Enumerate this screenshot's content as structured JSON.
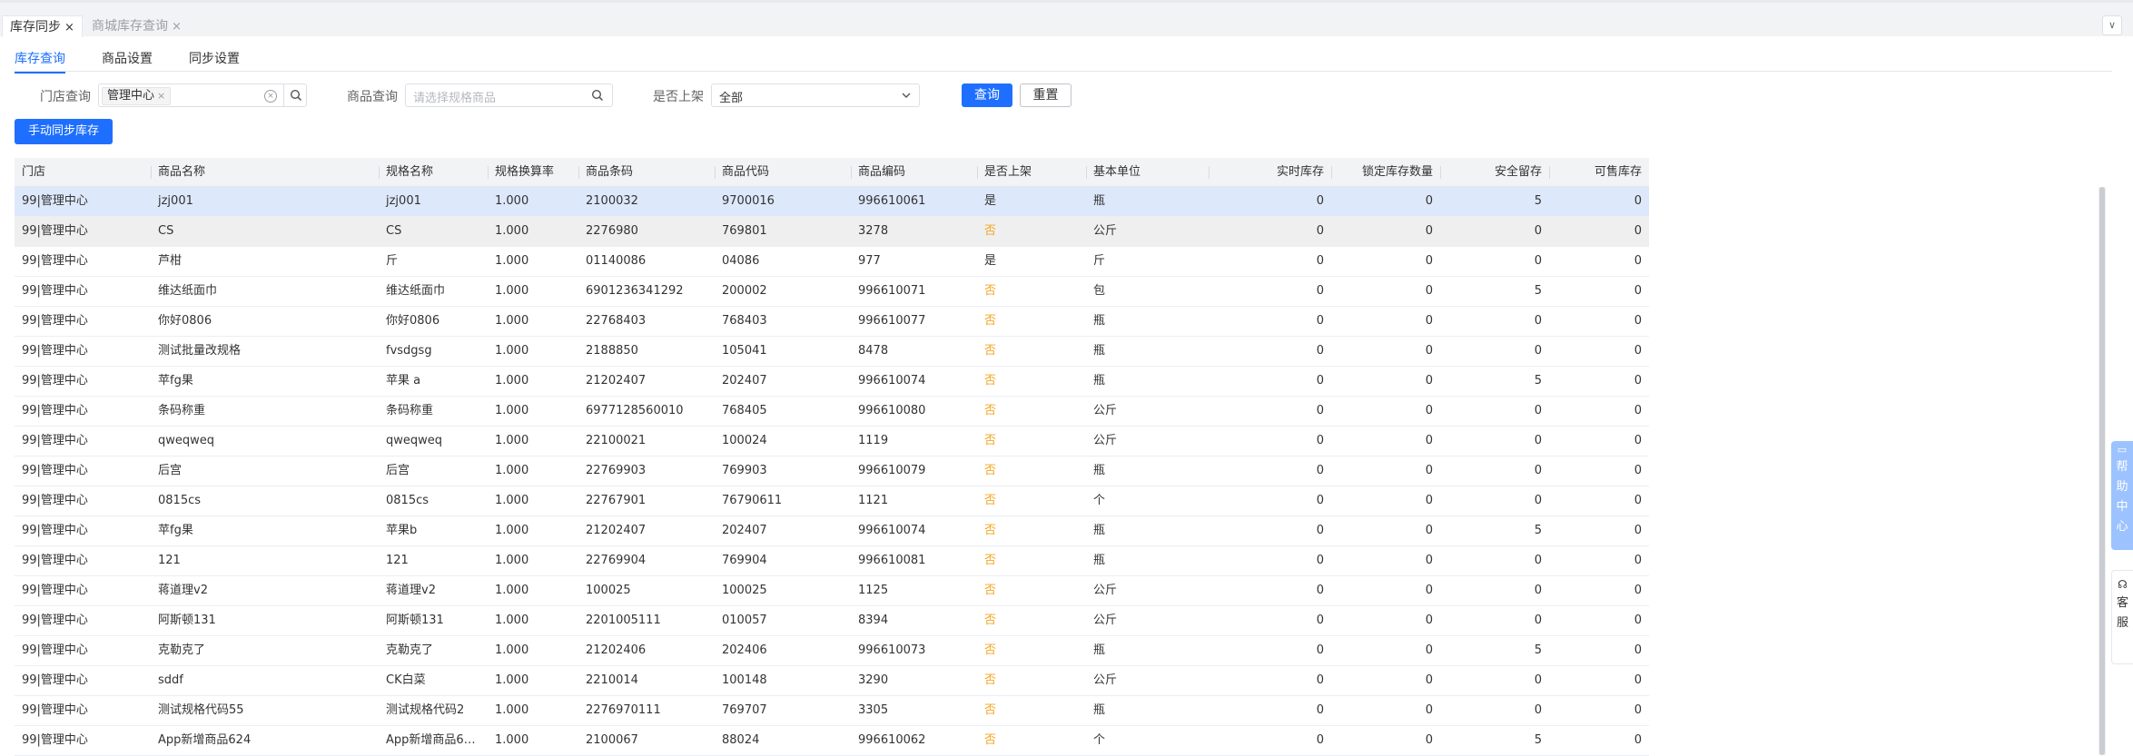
{
  "page_tabs": [
    {
      "label": "库存同步",
      "active": true
    },
    {
      "label": "商城库存查询",
      "active": false
    }
  ],
  "close_glyph": "×",
  "menu_glyph": "∨",
  "sub_tabs": [
    "库存查询",
    "商品设置",
    "同步设置"
  ],
  "filters": {
    "store_label": "门店查询",
    "store_chip": "管理中心",
    "product_label": "商品查询",
    "product_placeholder": "请选择规格商品",
    "listed_label": "是否上架",
    "listed_value": "全部",
    "query_button": "查询",
    "reset_button": "重置"
  },
  "sync_button": "手动同步库存",
  "table": {
    "columns": [
      "门店",
      "商品名称",
      "规格名称",
      "规格换算率",
      "商品条码",
      "商品代码",
      "商品编码",
      "是否上架",
      "基本单位",
      "实时库存",
      "锁定库存数量",
      "安全留存",
      "可售库存"
    ],
    "rows": [
      [
        "99|管理中心",
        "jzj001",
        "jzj001",
        "1.000",
        "2100032",
        "9700016",
        "996610061",
        "是",
        "瓶",
        "0",
        "0",
        "5",
        "0"
      ],
      [
        "99|管理中心",
        "CS",
        "CS",
        "1.000",
        "2276980",
        "769801",
        "3278",
        "否",
        "公斤",
        "0",
        "0",
        "0",
        "0"
      ],
      [
        "99|管理中心",
        "芦柑",
        "斤",
        "1.000",
        "01140086",
        "04086",
        "977",
        "是",
        "斤",
        "0",
        "0",
        "0",
        "0"
      ],
      [
        "99|管理中心",
        "维达纸面巾",
        "维达纸面巾",
        "1.000",
        "6901236341292",
        "200002",
        "996610071",
        "否",
        "包",
        "0",
        "0",
        "5",
        "0"
      ],
      [
        "99|管理中心",
        "你好0806",
        "你好0806",
        "1.000",
        "22768403",
        "768403",
        "996610077",
        "否",
        "瓶",
        "0",
        "0",
        "0",
        "0"
      ],
      [
        "99|管理中心",
        "测试批量改规格",
        "fvsdgsg",
        "1.000",
        "2188850",
        "105041",
        "8478",
        "否",
        "瓶",
        "0",
        "0",
        "0",
        "0"
      ],
      [
        "99|管理中心",
        "苹fg果",
        "苹果 a",
        "1.000",
        "21202407",
        "202407",
        "996610074",
        "否",
        "瓶",
        "0",
        "0",
        "5",
        "0"
      ],
      [
        "99|管理中心",
        "条码称重",
        "条码称重",
        "1.000",
        "6977128560010",
        "768405",
        "996610080",
        "否",
        "公斤",
        "0",
        "0",
        "0",
        "0"
      ],
      [
        "99|管理中心",
        "qweqweq",
        "qweqweq",
        "1.000",
        "22100021",
        "100024",
        "1119",
        "否",
        "公斤",
        "0",
        "0",
        "0",
        "0"
      ],
      [
        "99|管理中心",
        "后宫",
        "后宫",
        "1.000",
        "22769903",
        "769903",
        "996610079",
        "否",
        "瓶",
        "0",
        "0",
        "0",
        "0"
      ],
      [
        "99|管理中心",
        "0815cs",
        "0815cs",
        "1.000",
        "22767901",
        "76790611",
        "1121",
        "否",
        "个",
        "0",
        "0",
        "0",
        "0"
      ],
      [
        "99|管理中心",
        "苹fg果",
        "苹果b",
        "1.000",
        "21202407",
        "202407",
        "996610074",
        "否",
        "瓶",
        "0",
        "0",
        "5",
        "0"
      ],
      [
        "99|管理中心",
        "121",
        "121",
        "1.000",
        "22769904",
        "769904",
        "996610081",
        "否",
        "瓶",
        "0",
        "0",
        "0",
        "0"
      ],
      [
        "99|管理中心",
        "蒋道理v2",
        "蒋道理v2",
        "1.000",
        "100025",
        "100025",
        "1125",
        "否",
        "公斤",
        "0",
        "0",
        "0",
        "0"
      ],
      [
        "99|管理中心",
        "阿斯顿131",
        "阿斯顿131",
        "1.000",
        "2201005111",
        "010057",
        "8394",
        "否",
        "公斤",
        "0",
        "0",
        "0",
        "0"
      ],
      [
        "99|管理中心",
        "克勒克了",
        "克勒克了",
        "1.000",
        "21202406",
        "202406",
        "996610073",
        "否",
        "瓶",
        "0",
        "0",
        "5",
        "0"
      ],
      [
        "99|管理中心",
        "sddf",
        "CK白菜",
        "1.000",
        "2210014",
        "100148",
        "3290",
        "否",
        "公斤",
        "0",
        "0",
        "0",
        "0"
      ],
      [
        "99|管理中心",
        "测试规格代码55",
        "测试规格代码2",
        "1.000",
        "2276970111",
        "769707",
        "3305",
        "否",
        "瓶",
        "0",
        "0",
        "0",
        "0"
      ],
      [
        "99|管理中心",
        "App新增商品624",
        "App新增商品6…",
        "1.000",
        "2100067",
        "88024",
        "996610062",
        "否",
        "个",
        "0",
        "0",
        "5",
        "0"
      ]
    ]
  },
  "side": {
    "help_label": "帮助中心",
    "service_label": "客服"
  },
  "colors": {
    "primary": "#1e6fff",
    "selected_row": "#dde8fb",
    "hover_row": "#efefef",
    "not_listed": "#f5a623"
  }
}
